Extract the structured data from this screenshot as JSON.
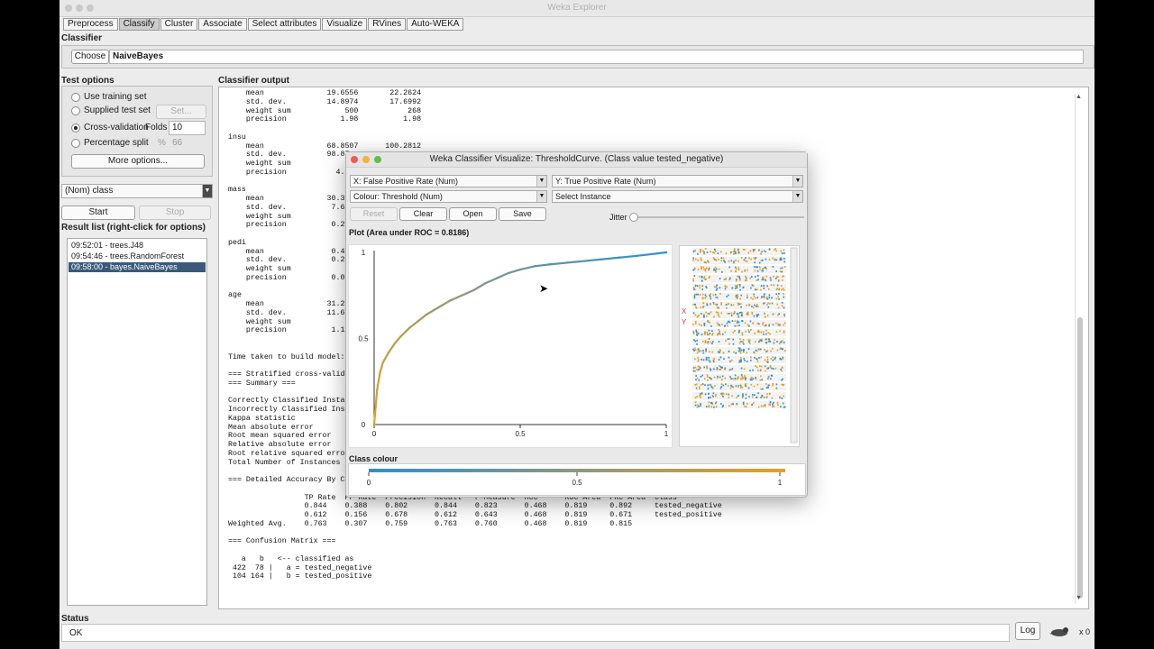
{
  "window_title": "Weka Explorer",
  "tabs": [
    "Preprocess",
    "Classify",
    "Cluster",
    "Associate",
    "Select attributes",
    "Visualize",
    "RVines",
    "Auto-WEKA"
  ],
  "active_tab": "Classify",
  "classifier": {
    "section": "Classifier",
    "choose_label": "Choose",
    "name": "NaiveBayes"
  },
  "test_options": {
    "section": "Test options",
    "use_training": "Use training set",
    "supplied_test": "Supplied test set",
    "set_label": "Set...",
    "cross_validation": "Cross-validation",
    "folds_label": "Folds",
    "folds_value": "10",
    "percentage_split": "Percentage split",
    "percent_sign": "%",
    "percent_value": "66",
    "more_options": "More options...",
    "selected": "cross_validation"
  },
  "class_select": "(Nom) class",
  "start_label": "Start",
  "stop_label": "Stop",
  "result_list": {
    "label": "Result list (right-click for options)",
    "items": [
      "09:52:01 - trees.J48",
      "09:54:46 - trees.RandomForest",
      "09:58:00 - bayes.NaiveBayes"
    ],
    "selected_index": 2
  },
  "output_label": "Classifier output",
  "output_lines": [
    "    mean              19.6556       22.2624",
    "    std. dev.         14.8974       17.6992",
    "    weight sum            500           268",
    "    precision            1.98          1.98",
    "",
    "insu",
    "    mean              68.8507      100.2812",
    "    std. dev.         98.87",
    "    weight sum            5",
    "    precision           4.5",
    "",
    "mass",
    "    mean              30.30",
    "    std. dev.          7.68",
    "    weight sum            5",
    "    precision          0.27",
    "",
    "pedi",
    "    mean               0.42",
    "    std. dev.          0.29",
    "    weight sum            5",
    "    precision          0.00",
    "",
    "age",
    "    mean              31.24",
    "    std. dev.         11.66",
    "    weight sum            5",
    "    precision          1.17",
    "",
    "",
    "Time taken to build model: 0",
    "",
    "=== Stratified cross-validati",
    "=== Summary ===",
    "",
    "Correctly Classified Instance",
    "Incorrectly Classified Instan",
    "Kappa statistic",
    "Mean absolute error",
    "Root mean squared error",
    "Relative absolute error",
    "Root relative squared error",
    "Total Number of Instances",
    "",
    "=== Detailed Accuracy By Clas",
    "",
    "                 TP Rate  FP Rate  Precision  Recall   F-Measure  MCC      ROC Area  PRC Area  Class",
    "                 0.844    0.388    0.802      0.844    0.823      0.468    0.819     0.892     tested_negative",
    "                 0.612    0.156    0.678      0.612    0.643      0.468    0.819     0.671     tested_positive",
    "Weighted Avg.    0.763    0.307    0.759      0.763    0.760      0.468    0.819     0.815",
    "",
    "=== Confusion Matrix ===",
    "",
    "   a   b   <-- classified as",
    " 422  78 |   a = tested_negative",
    " 104 164 |   b = tested_positive"
  ],
  "status": {
    "label": "Status",
    "text": "OK",
    "log_label": "Log",
    "count": "x 0"
  },
  "dialog": {
    "title": "Weka Classifier Visualize: ThresholdCurve. (Class value tested_negative)",
    "x_axis": "X: False Positive Rate (Num)",
    "y_axis": "Y: True Positive Rate (Num)",
    "colour": "Colour: Threshold (Num)",
    "select_instance": "Select Instance",
    "reset_label": "Reset",
    "clear_label": "Clear",
    "open_label": "Open",
    "save_label": "Save",
    "jitter_label": "Jitter",
    "plot_label": "Plot (Area under ROC = 0.8186)",
    "class_colour_label": "Class colour",
    "side_x_label": "X",
    "side_y_label": "Y",
    "colors": {
      "low": "#2f8fd0",
      "high": "#e8a020"
    }
  },
  "chart_data": {
    "type": "line",
    "xlabel": "",
    "ylabel": "",
    "xlim": [
      0,
      1
    ],
    "ylim": [
      0,
      1
    ],
    "x_ticks": [
      "0",
      "0.5",
      "1"
    ],
    "y_ticks": [
      "0",
      "0.5",
      "1"
    ],
    "colour_ticks": [
      "0",
      "0.5",
      "1"
    ],
    "series": [
      {
        "x": [
          0,
          0.005,
          0.01,
          0.02,
          0.03,
          0.05,
          0.07,
          0.09,
          0.12,
          0.15,
          0.18,
          0.22,
          0.26,
          0.3,
          0.34,
          0.38,
          0.42,
          0.46,
          0.5,
          0.55,
          0.6,
          0.66,
          0.72,
          0.78,
          0.84,
          0.9,
          0.95,
          1
        ],
        "y": [
          0,
          0.1,
          0.2,
          0.3,
          0.36,
          0.42,
          0.47,
          0.51,
          0.56,
          0.6,
          0.64,
          0.68,
          0.72,
          0.75,
          0.78,
          0.82,
          0.85,
          0.88,
          0.9,
          0.92,
          0.93,
          0.94,
          0.95,
          0.96,
          0.97,
          0.98,
          0.99,
          1
        ]
      }
    ]
  }
}
